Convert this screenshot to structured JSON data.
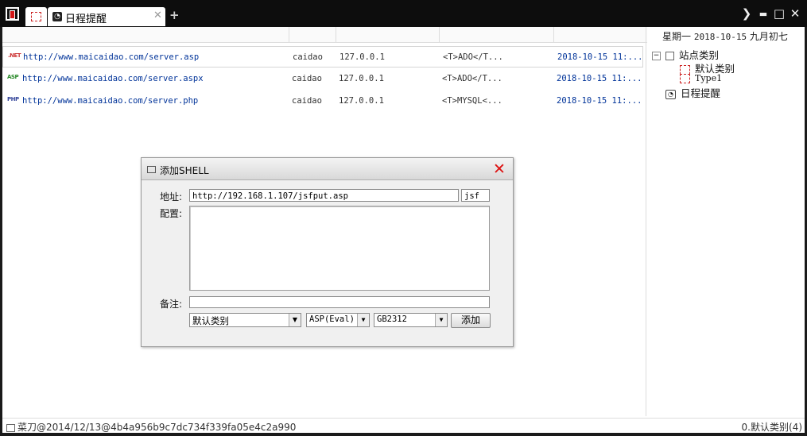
{
  "titlebar": {
    "tabs": [
      {
        "label": ""
      },
      {
        "label": "日程提醒"
      }
    ],
    "add_tab": "+",
    "controls": {
      "expand": "❯",
      "minimize": "▬",
      "maximize": "□",
      "close": "✕"
    }
  },
  "shell_list": {
    "rows": [
      {
        "icon": ".NET",
        "url": "http://www.maicaidao.com/server.asp",
        "user": "caidao",
        "ip": "127.0.0.1",
        "note": "<T>ADO</T...",
        "time": "2018-10-15 11:..."
      },
      {
        "icon": "ASP",
        "url": "http://www.maicaidao.com/server.aspx",
        "user": "caidao",
        "ip": "127.0.0.1",
        "note": "<T>ADO</T...",
        "time": "2018-10-15 11:..."
      },
      {
        "icon": "PHP",
        "url": "http://www.maicaidao.com/server.php",
        "user": "caidao",
        "ip": "127.0.0.1",
        "note": "<T>MYSQL<...",
        "time": "2018-10-15 11:..."
      }
    ]
  },
  "side_panel": {
    "weekday": "星期一",
    "date": "2018-10-15",
    "lunar": "九月初七",
    "tree": {
      "root": "站点类别",
      "children": [
        "默认类别",
        "Type1"
      ],
      "schedule": "日程提醒"
    }
  },
  "status": {
    "left": "菜刀@2014/12/13@4b4a956b9c7dc734f339fa05e4c2a990",
    "right": "0.默认类别(4)"
  },
  "dialog": {
    "title": "添加SHELL",
    "address_label": "地址:",
    "address_value": "http://192.168.1.107/jsfput.asp",
    "password_value": "jsf",
    "config_label": "配置:",
    "config_value": "",
    "remark_label": "备注:",
    "remark_value": "",
    "category": "默认类别",
    "script_type": "ASP(Eval)",
    "encoding": "GB2312",
    "add_button": "添加"
  },
  "colors": {
    "accent_link": "#003399",
    "close_red": "#dd1111",
    "titlebar": "#0d0d0d"
  }
}
